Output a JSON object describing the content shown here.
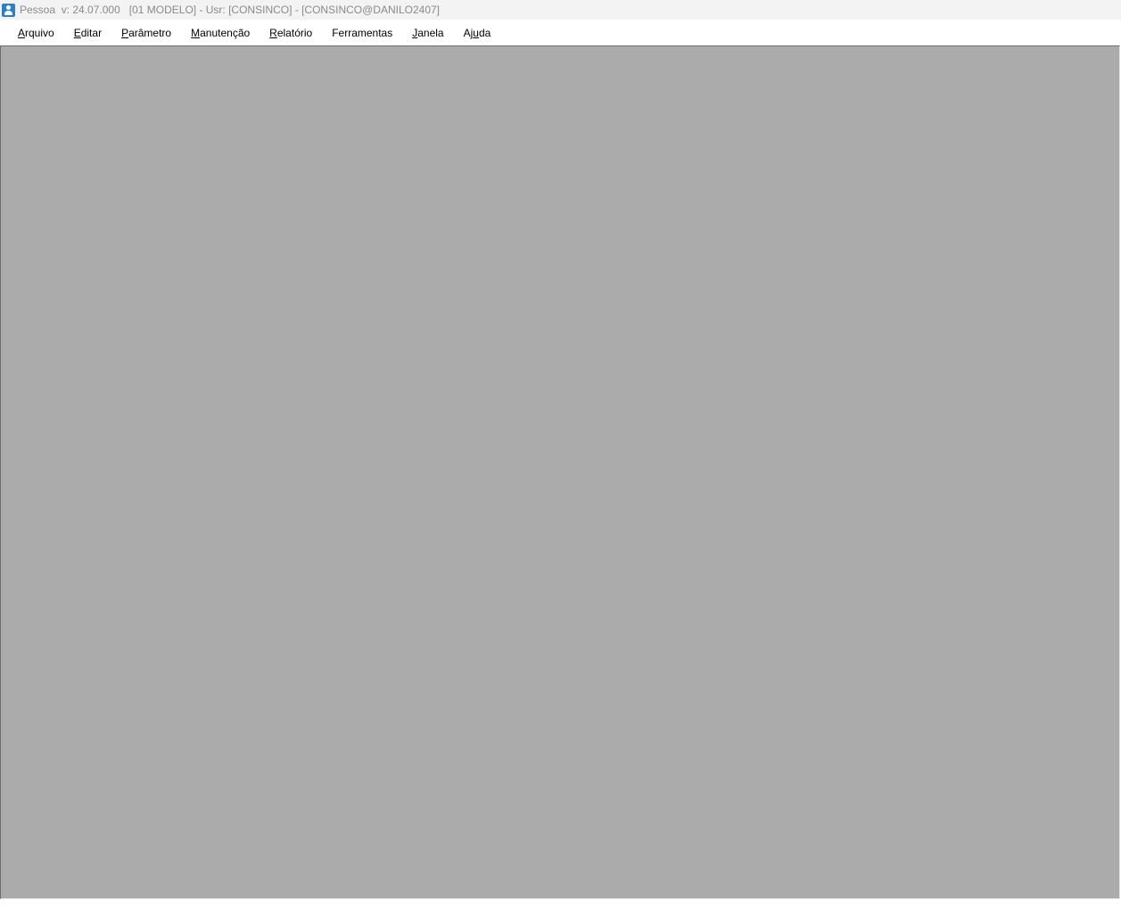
{
  "window": {
    "title": "Pessoa  v: 24.07.000   [01 MODELO] - Usr: [CONSINCO] - [CONSINCO@DANILO2407]",
    "icon": "person-icon"
  },
  "menubar": {
    "items": [
      {
        "label": "Arquivo",
        "mnemonic_index": 0
      },
      {
        "label": "Editar",
        "mnemonic_index": 0
      },
      {
        "label": "Parâmetro",
        "mnemonic_index": 0
      },
      {
        "label": "Manutenção",
        "mnemonic_index": 0
      },
      {
        "label": "Relatório",
        "mnemonic_index": 0
      },
      {
        "label": "Ferramentas",
        "mnemonic_index": -1
      },
      {
        "label": "Janela",
        "mnemonic_index": 0
      },
      {
        "label": "Ajuda",
        "mnemonic_index": 2
      }
    ]
  },
  "colors": {
    "titlebar_bg": "#f3f3f3",
    "title_text": "#8a8a8a",
    "icon_accent": "#2f7fc1",
    "mdi_background": "#ababab"
  }
}
